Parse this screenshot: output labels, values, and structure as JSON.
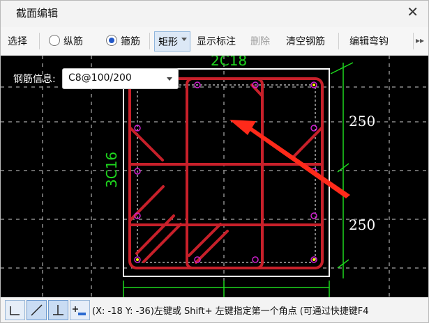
{
  "window": {
    "title": "截面编辑"
  },
  "toolbar": {
    "select_label": "选择",
    "longitudinal_label": "纵筋",
    "stirrup_label": "箍筋",
    "shape_label": "矩形",
    "show_annotation_label": "显示标注",
    "delete_label": "删除",
    "clear_rebar_label": "清空钢筋",
    "edit_hook_label": "编辑弯钩",
    "selected_radio": "箍筋"
  },
  "rebar_info": {
    "label": "钢筋信息:",
    "value": "C8@100/200"
  },
  "drawing": {
    "top_label": "2C18",
    "left_label": "3C16",
    "dim_upper": "250",
    "dim_lower": "250",
    "colors": {
      "rebar": "#c8202a",
      "dim": "#1ed81e",
      "outline": "#ffffff",
      "marker": "#d020d0",
      "arrow": "#ff2a1a"
    }
  },
  "status": {
    "text": "(X: -18 Y: -36)左键或 Shift+ 左键指定第一个角点 (可通过快捷键F4"
  },
  "icons": [
    "orthogonal-icon",
    "angle-line-icon",
    "perpendicular-icon",
    "add-point-icon",
    "close-icon",
    "chevron-right-icon"
  ]
}
